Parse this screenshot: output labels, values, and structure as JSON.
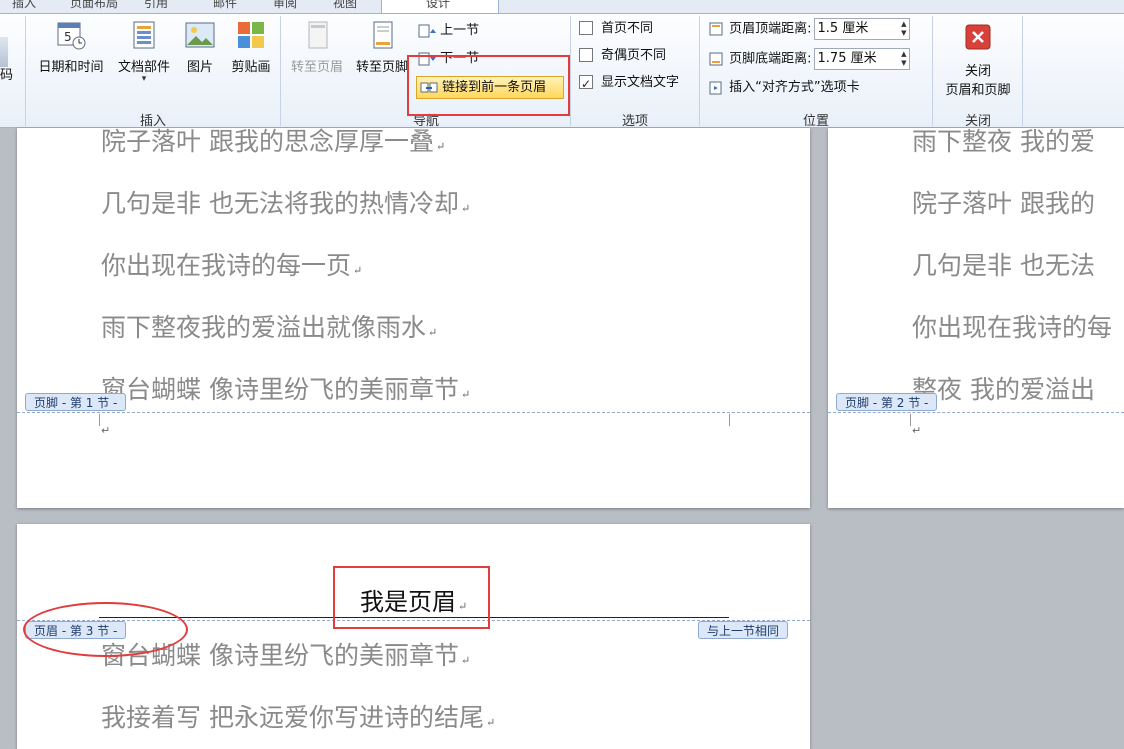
{
  "ribbon": {
    "tabs": [
      "插入",
      "页面布局",
      "引用",
      "邮件",
      "审阅",
      "视图",
      "设计"
    ],
    "insert_group": {
      "label": "插入",
      "partial_left_label": "码",
      "buttons": [
        {
          "label": "日期和时间",
          "icon": "calendar-clock-icon"
        },
        {
          "label": "文档部件",
          "icon": "document-parts-icon",
          "dropdown": "▾"
        },
        {
          "label": "图片",
          "icon": "picture-icon"
        },
        {
          "label": "剪贴画",
          "icon": "clipart-icon"
        }
      ]
    },
    "nav_group": {
      "label": "导航",
      "goto_header": "转至页眉",
      "goto_footer": "转至页脚",
      "prev_section": "上一节",
      "next_section": "下一节",
      "link_to_previous": "链接到前一条页眉"
    },
    "options_group": {
      "label": "选项",
      "different_first_page": "首页不同",
      "different_odd_even": "奇偶页不同",
      "show_document_text": "显示文档文字",
      "show_document_text_checked": true
    },
    "position_group": {
      "label": "位置",
      "header_top_label": "页眉顶端距离:",
      "header_top_value": "1.5 厘米",
      "footer_bottom_label": "页脚底端距离:",
      "footer_bottom_value": "1.75 厘米",
      "insert_align_tab": "插入“对齐方式”选项卡"
    },
    "close_group": {
      "label": "关闭",
      "close_line1": "关闭",
      "close_line2": "页眉和页脚"
    }
  },
  "pages": {
    "page1_lines": [
      "院子落叶  跟我的思念厚厚一叠",
      "几句是非  也无法将我的热情冷却",
      "你出现在我诗的每一页",
      "雨下整夜我的爱溢出就像雨水",
      "窗台蝴蝶  像诗里纷飞的美丽章节"
    ],
    "page2_lines": [
      "雨下整夜  我的爱",
      "院子落叶  跟我的",
      "几句是非  也无法",
      "你出现在我诗的每",
      "整夜  我的爱溢出"
    ],
    "page3_lines": [
      "窗台蝴蝶  像诗里纷飞的美丽章节",
      "我接着写  把永远爱你写进诗的结尾"
    ],
    "footer_tag_1": "页脚 - 第 1 节 -",
    "footer_tag_2": "页脚 - 第 2 节 -",
    "header_tag_3": "页眉 - 第 3 节 -",
    "same_as_previous": "与上一节相同",
    "header_text": "我是页眉",
    "para_mark": "↵"
  }
}
